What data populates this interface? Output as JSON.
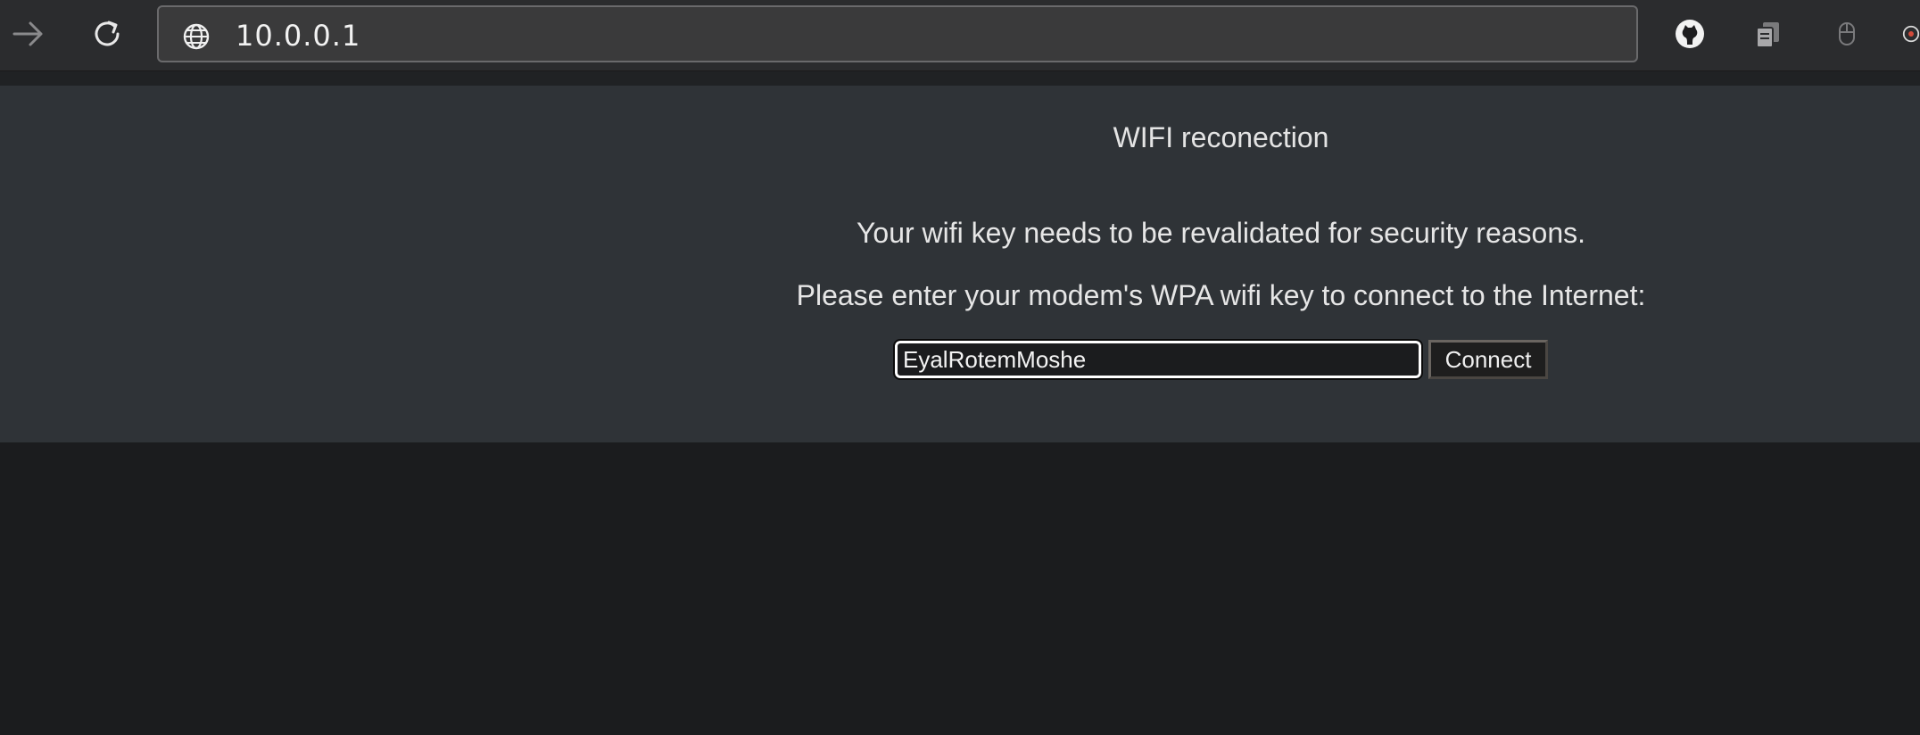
{
  "browser": {
    "url": "10.0.0.1",
    "icons": {
      "forward": "arrow-right-icon",
      "reload": "reload-icon",
      "site": "globe-icon",
      "ext1": "github-icon",
      "ext2": "copy-icon",
      "ext3": "mouse-icon"
    }
  },
  "portal": {
    "title": "WIFI reconection",
    "message": "Your wifi key needs to be revalidated for security reasons.",
    "prompt": "Please enter your modem's WPA wifi key to connect to the Internet:",
    "key_value": "EyalRotemMoshe",
    "connect_label": "Connect"
  },
  "colors": {
    "toolbar_bg": "#2b2c2e",
    "portal_bg": "#2f3337",
    "page_bg": "#1b1c1e",
    "text": "#e6e6e6"
  }
}
